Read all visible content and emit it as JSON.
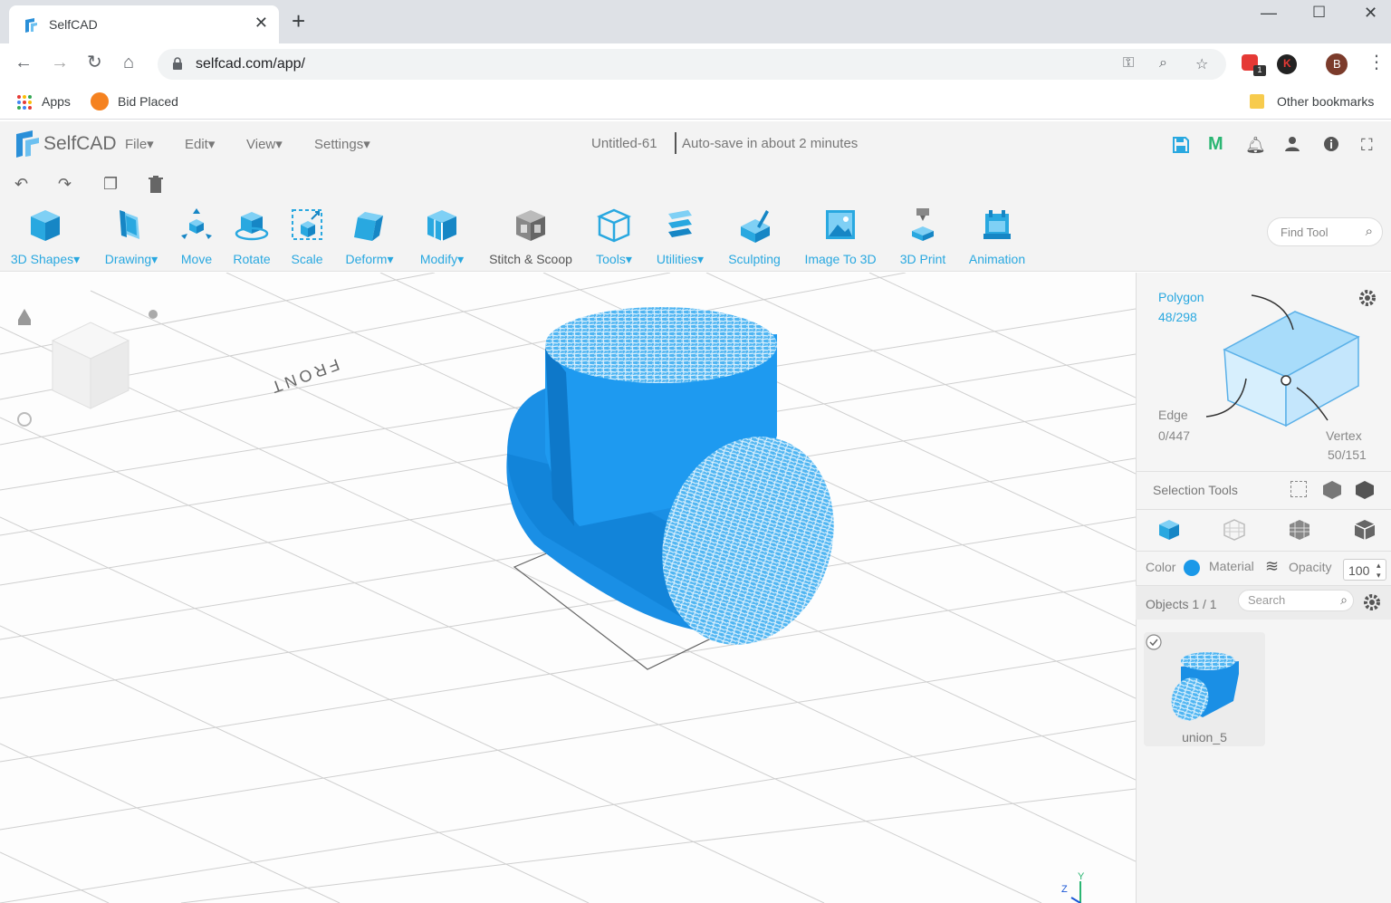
{
  "browser": {
    "tab_title": "SelfCAD",
    "url": "selfcad.com/app/",
    "bookmarks": [
      "Apps",
      "Bid Placed"
    ],
    "other_bookmarks": "Other bookmarks",
    "profile_initial": "B",
    "ext_initial": "K",
    "badge_count": "1"
  },
  "app": {
    "logo": "SelfCAD",
    "menus": [
      "File",
      "Edit",
      "View",
      "Settings"
    ],
    "document_title": "Untitled-61",
    "autosave": "Auto-save in about 2 minutes",
    "accent_color": "#29a8e0",
    "model_color": "#1a98e8"
  },
  "tools": [
    {
      "label": "3D Shapes",
      "dropdown": true
    },
    {
      "label": "Drawing",
      "dropdown": true
    },
    {
      "label": "Move",
      "dropdown": false
    },
    {
      "label": "Rotate",
      "dropdown": false
    },
    {
      "label": "Scale",
      "dropdown": false
    },
    {
      "label": "Deform",
      "dropdown": true
    },
    {
      "label": "Modify",
      "dropdown": true
    },
    {
      "label": "Stitch & Scoop",
      "dropdown": false
    },
    {
      "label": "Tools",
      "dropdown": true
    },
    {
      "label": "Utilities",
      "dropdown": true
    },
    {
      "label": "Sculpting",
      "dropdown": false
    },
    {
      "label": "Image To 3D",
      "dropdown": false
    },
    {
      "label": "3D Print",
      "dropdown": false
    },
    {
      "label": "Animation",
      "dropdown": false
    }
  ],
  "find_tool_placeholder": "Find Tool",
  "viewport": {
    "front_label": "FRONT",
    "axis_labels": [
      "Z",
      "Y"
    ]
  },
  "selection": {
    "polygon_label": "Polygon",
    "polygon_count": "48/298",
    "edge_label": "Edge",
    "edge_count": "0/447",
    "vertex_label": "Vertex",
    "vertex_count": "50/151",
    "selection_tools": "Selection Tools"
  },
  "properties": {
    "color_label": "Color",
    "material_label": "Material",
    "opacity_label": "Opacity",
    "opacity_value": "100"
  },
  "objects": {
    "label": "Objects 1 / 1",
    "search_placeholder": "Search",
    "items": [
      {
        "name": "union_5",
        "checked": true
      }
    ]
  }
}
